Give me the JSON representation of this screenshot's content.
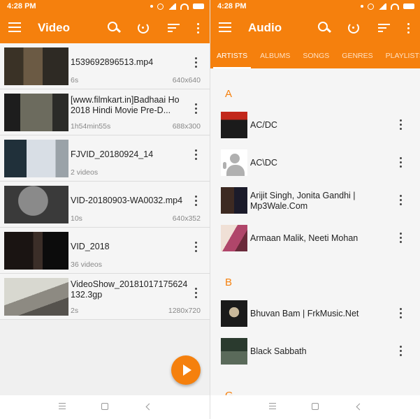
{
  "colors": {
    "accent": "#f5800d",
    "secondary_text": "#888888"
  },
  "left": {
    "status": {
      "time": "4:28 PM"
    },
    "appbar": {
      "title": "Video"
    },
    "videos": [
      {
        "name": "1539692896513.mp4",
        "meta": "6s",
        "resolution": "640x640"
      },
      {
        "name": "[www.filmkart.in]Badhaai Ho 2018 Hindi Movie Pre-D...",
        "meta": "1h54min55s",
        "resolution": "688x300"
      },
      {
        "name": "FJVID_20180924_14",
        "meta": "2 videos",
        "resolution": ""
      },
      {
        "name": "VID-20180903-WA0032.mp4",
        "meta": "10s",
        "resolution": "640x352"
      },
      {
        "name": "VID_2018",
        "meta": "36 videos",
        "resolution": ""
      },
      {
        "name": "VideoShow_20181017175624132.3gp",
        "meta": "2s",
        "resolution": "1280x720"
      }
    ]
  },
  "right": {
    "status": {
      "time": "4:28 PM"
    },
    "appbar": {
      "title": "Audio"
    },
    "tabs": [
      "ARTISTS",
      "ALBUMS",
      "SONGS",
      "GENRES",
      "PLAYLISTS"
    ],
    "sections": [
      {
        "letter": "A",
        "artists": [
          "AC/DC",
          "AC\\DC",
          "Arijit Singh, Jonita Gandhi | Mp3Wale.Com",
          "Armaan Malik, Neeti Mohan"
        ]
      },
      {
        "letter": "B",
        "artists": [
          "Bhuvan Bam | FrkMusic.Net",
          "Black Sabbath"
        ]
      },
      {
        "letter": "G",
        "artists": []
      }
    ]
  }
}
